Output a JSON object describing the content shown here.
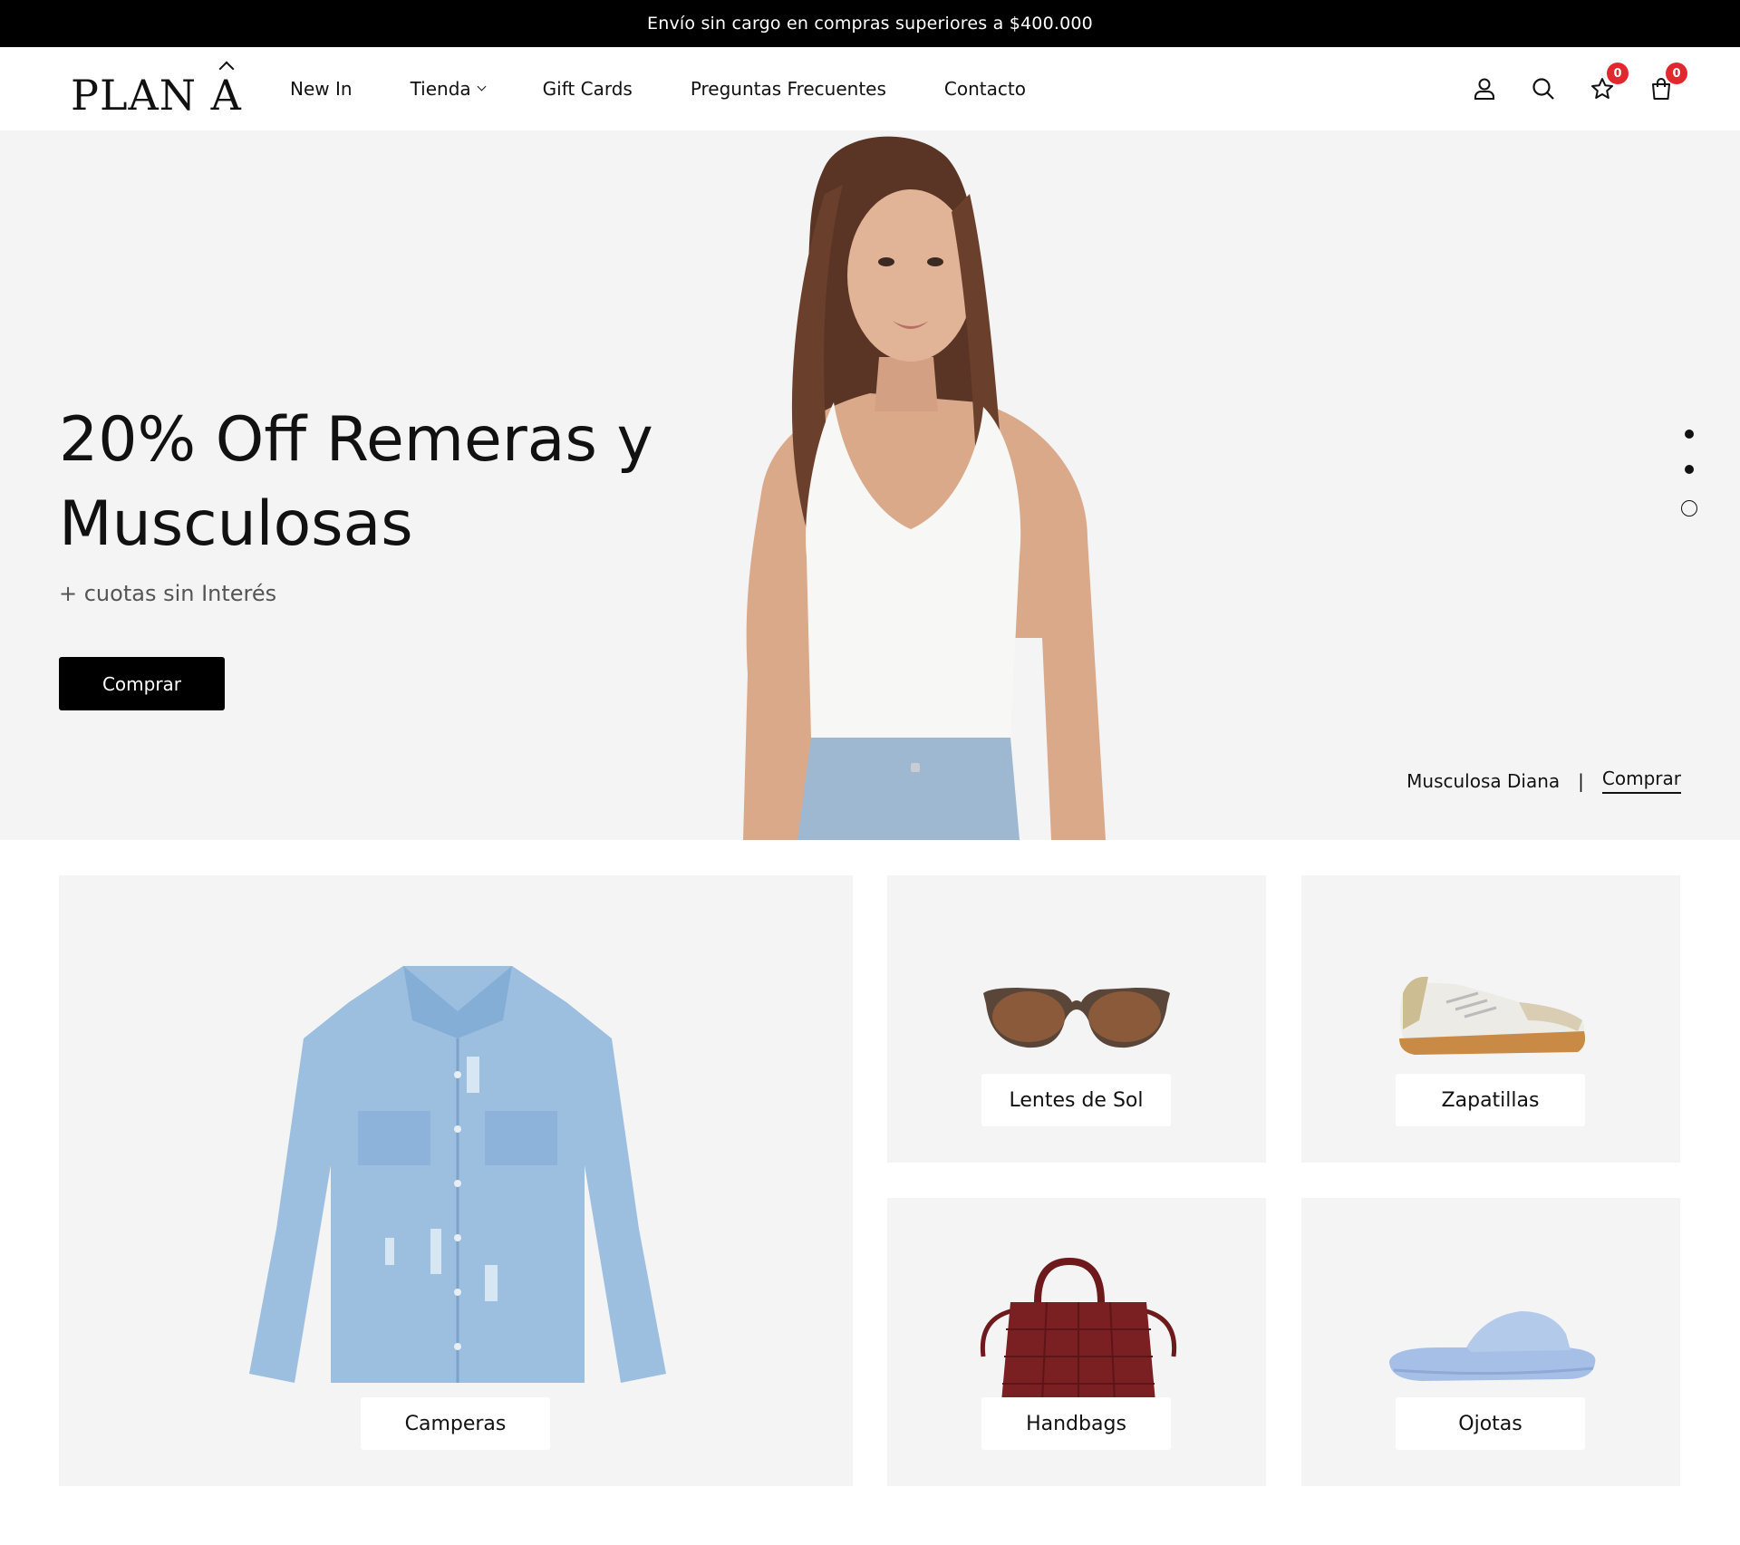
{
  "announcement": "Envío sin cargo en compras superiores a $400.000",
  "logo": {
    "text_a": "PLAN",
    "text_b": "A"
  },
  "nav": [
    {
      "label": "New In"
    },
    {
      "label": "Tienda"
    },
    {
      "label": "Gift Cards"
    },
    {
      "label": "Preguntas Frecuentes"
    },
    {
      "label": "Contacto"
    }
  ],
  "header_icons": {
    "wishlist_count": "0",
    "cart_count": "0"
  },
  "hero": {
    "title": "20% Off Remeras y Musculosas",
    "subtitle": "+ cuotas sin Interés",
    "button": "Comprar",
    "caption_product": "Musculosa Diana",
    "caption_separator": "|",
    "caption_link": "Comprar",
    "slides": 3,
    "active_slide": 3
  },
  "categories": [
    {
      "label": "Camperas"
    },
    {
      "label": "Lentes de Sol"
    },
    {
      "label": "Zapatillas"
    },
    {
      "label": "Handbags"
    },
    {
      "label": "Ojotas"
    }
  ],
  "colors": {
    "announcement_bg": "#000000",
    "badge": "#e0282e",
    "hero_bg": "#f4f4f4",
    "button_bg": "#000000"
  }
}
